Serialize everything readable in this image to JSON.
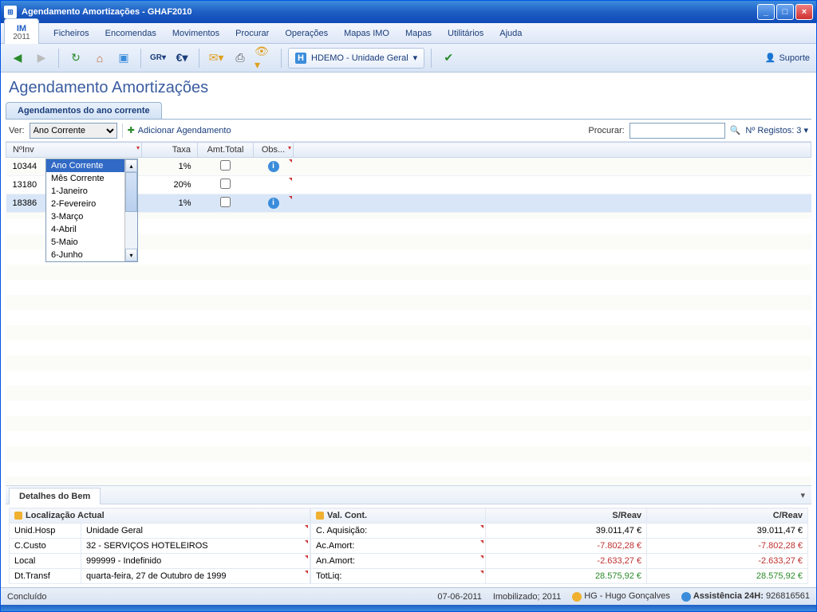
{
  "window": {
    "title": "Agendamento Amortizações - GHAF2010"
  },
  "logo": {
    "line1": "IM",
    "line2": "2011"
  },
  "menu": [
    "Ficheiros",
    "Encomendas",
    "Movimentos",
    "Procurar",
    "Operações",
    "Mapas IMO",
    "Mapas",
    "Utilitários",
    "Ajuda"
  ],
  "toolbar": {
    "hdemo_label": "HDEMO - Unidade Geral",
    "suporte_label": "Suporte"
  },
  "page_title": "Agendamento Amortizações",
  "tab_label": "Agendamentos do ano corrente",
  "filter": {
    "ver_label": "Ver:",
    "selected": "Ano Corrente",
    "options": [
      "Ano Corrente",
      "Mês Corrente",
      "1-Janeiro",
      "2-Fevereiro",
      "3-Março",
      "4-Abril",
      "5-Maio",
      "6-Junho"
    ],
    "add_label": "Adicionar Agendamento",
    "search_label": "Procurar:",
    "search_value": "",
    "count_label": "Nº Registos: 3"
  },
  "grid": {
    "headers": {
      "inv": "NºInv",
      "taxa": "Taxa",
      "amt": "Amt.Total",
      "obs": "Obs..."
    },
    "rows": [
      {
        "inv": "10344",
        "taxa": "1%",
        "amt": false,
        "obs_info": true
      },
      {
        "inv": "13180",
        "taxa": "20%",
        "amt": false,
        "obs_info": false
      },
      {
        "inv": "18386",
        "taxa": "1%",
        "amt": false,
        "obs_info": true,
        "selected": true
      }
    ]
  },
  "details": {
    "tab_label": "Detalhes do Bem",
    "loc_header": "Localização Actual",
    "loc_rows": [
      {
        "k": "Unid.Hosp",
        "v": "Unidade Geral"
      },
      {
        "k": "C.Custo",
        "v": "32 - SERVIÇOS HOTELEIROS"
      },
      {
        "k": "Local",
        "v": "999999 - Indefinido"
      },
      {
        "k": "Dt.Transf",
        "v": "quarta-feira, 27 de Outubro de 1999"
      }
    ],
    "val_headers": {
      "cont": "Val. Cont.",
      "sreav": "S/Reav",
      "creav": "C/Reav"
    },
    "val_rows": [
      {
        "k": "C. Aquisição:",
        "s": "39.011,47 €",
        "c": "39.011,47 €",
        "cls": ""
      },
      {
        "k": "Ac.Amort:",
        "s": "-7.802,28 €",
        "c": "-7.802,28 €",
        "cls": "neg"
      },
      {
        "k": "An.Amort:",
        "s": "-2.633,27 €",
        "c": "-2.633,27 €",
        "cls": "neg"
      },
      {
        "k": "TotLiq:",
        "s": "28.575,92 €",
        "c": "28.575,92 €",
        "cls": "pos",
        "tot": true
      }
    ]
  },
  "status": {
    "left": "Concluído",
    "date": "07-06-2011",
    "period": "Imobilizado; 2011",
    "user": "HG - Hugo Gonçalves",
    "assist_label": "Assistência 24H:",
    "assist_num": "926816561"
  }
}
